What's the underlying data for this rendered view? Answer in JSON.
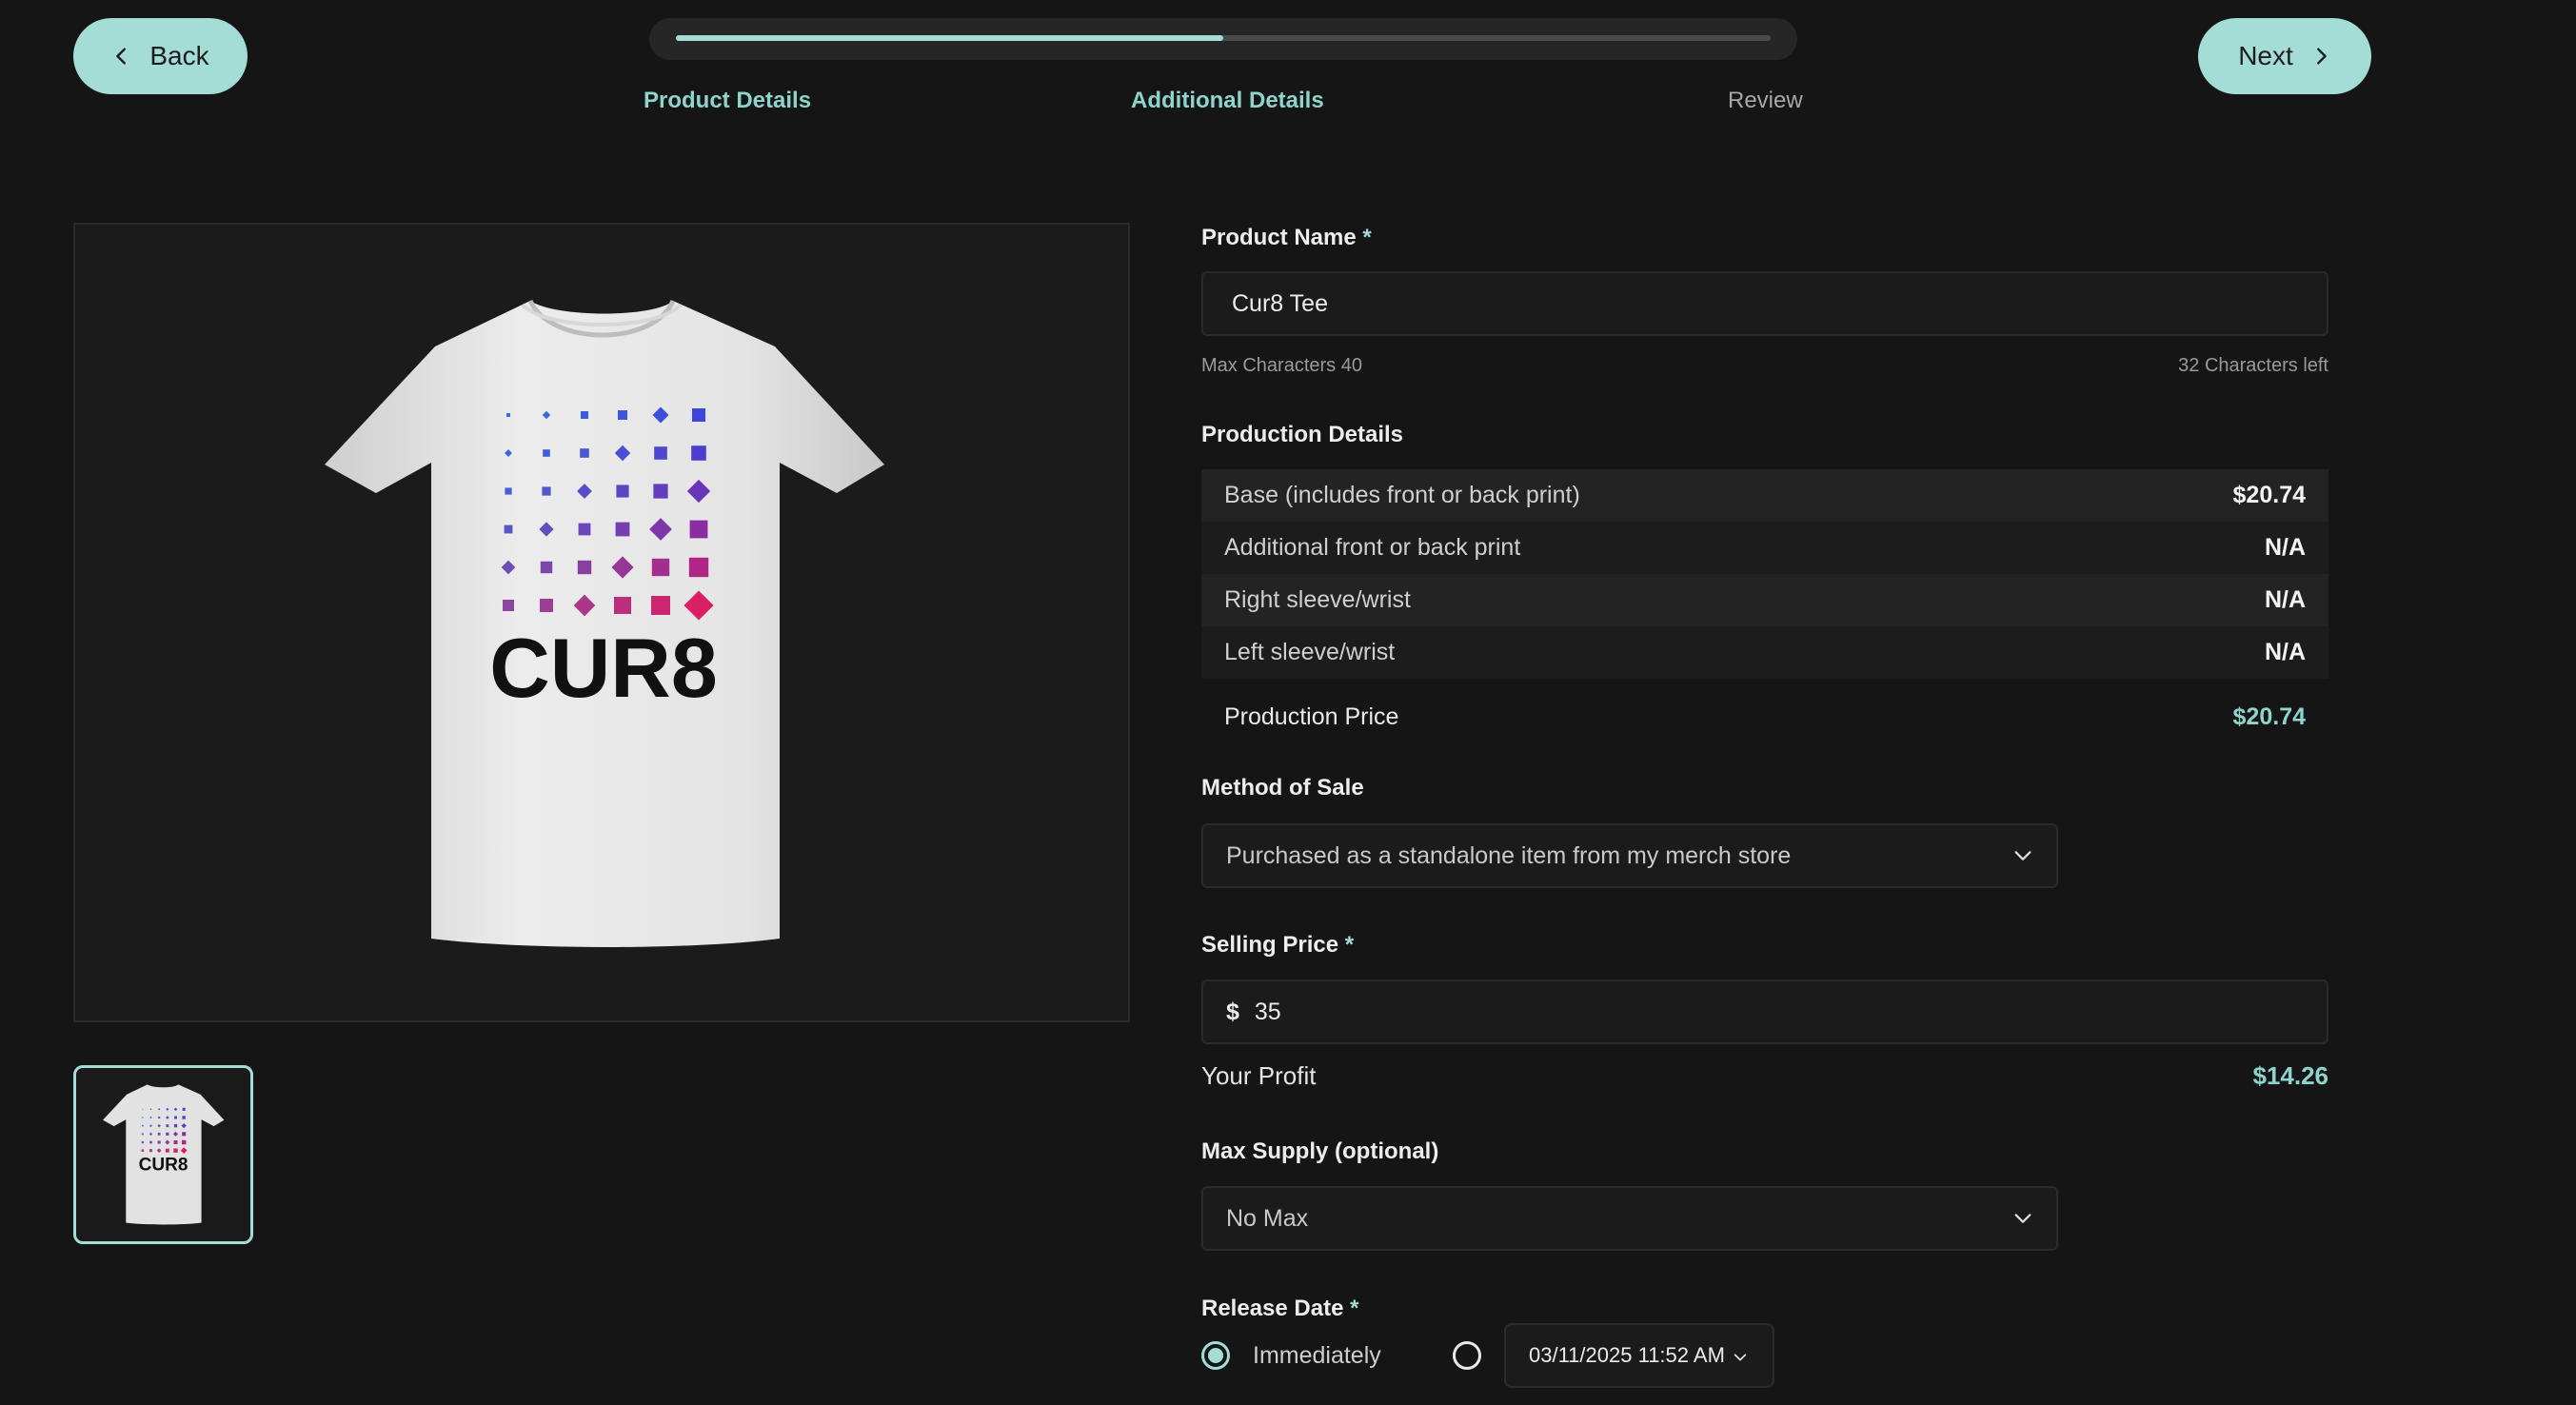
{
  "nav": {
    "back_label": "Back",
    "next_label": "Next",
    "progress_fraction": 0.5,
    "steps": [
      {
        "label": "Product Details",
        "state": "complete"
      },
      {
        "label": "Additional Details",
        "state": "current"
      },
      {
        "label": "Review",
        "state": "upcoming"
      }
    ]
  },
  "preview": {
    "shirt_brand_text": "CUR8"
  },
  "form": {
    "product_name": {
      "label": "Product Name",
      "required_mark": "*",
      "value": "Cur8 Tee",
      "max_note": "Max Characters 40",
      "remaining_note": "32 Characters left"
    },
    "production": {
      "label": "Production Details",
      "rows": [
        {
          "name": "Base (includes front or back print)",
          "value": "$20.74"
        },
        {
          "name": "Additional front or back print",
          "value": "N/A"
        },
        {
          "name": "Right sleeve/wrist",
          "value": "N/A"
        },
        {
          "name": "Left sleeve/wrist",
          "value": "N/A"
        }
      ],
      "total_label": "Production Price",
      "total_value": "$20.74"
    },
    "method_of_sale": {
      "label": "Method of Sale",
      "selected": "Purchased as a standalone item from my merch store"
    },
    "selling_price": {
      "label": "Selling Price",
      "required_mark": "*",
      "currency": "$",
      "value": "35"
    },
    "profit": {
      "label": "Your Profit",
      "value": "$14.26"
    },
    "max_supply": {
      "label": "Max Supply (optional)",
      "selected": "No Max"
    },
    "release_date": {
      "label": "Release Date",
      "required_mark": "*",
      "option_immediately": "Immediately",
      "date_value": "03/11/2025 11:52 AM"
    }
  },
  "colors": {
    "accent": "#a4dcd6",
    "background": "#151515"
  }
}
